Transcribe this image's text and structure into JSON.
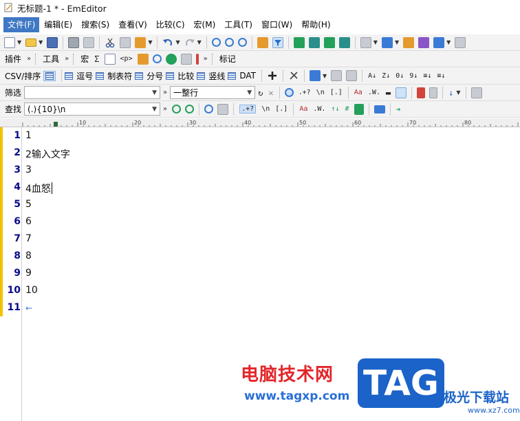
{
  "window": {
    "title": "无标题-1 * - EmEditor"
  },
  "menu": [
    "文件(F)",
    "编辑(E)",
    "搜索(S)",
    "查看(V)",
    "比较(C)",
    "宏(M)",
    "工具(T)",
    "窗口(W)",
    "帮助(H)"
  ],
  "menu_active_index": 0,
  "toolbar2": {
    "plugins_label": "插件",
    "tools_label": "工具",
    "more": "»",
    "macro_label": "宏",
    "sigma": "Σ",
    "p_tag": "<p>",
    "bookmark_label": "标记"
  },
  "csv_toolbar": {
    "csv_sort_label": "CSV/排序",
    "buttons": [
      "逗号",
      "制表符",
      "分号",
      "比较",
      "竖线",
      "DAT"
    ]
  },
  "filter_toolbar": {
    "label": "筛选",
    "filter_value": "",
    "scope_value": "一整行",
    "regex_label": ".+?",
    "newline_label": "\\n",
    "bracket_label": "[.]",
    "case_label": "Aa",
    "word_label": ".W."
  },
  "find_toolbar": {
    "label": "查找",
    "find_value": "(.){10}\\n",
    "regex_label": ".+?",
    "newline_label": "\\n",
    "bracket_label": "[.]",
    "case_label": "Aa",
    "word_label": ".W."
  },
  "ruler": {
    "labels": [
      "10",
      "20",
      "30",
      "40",
      "50",
      "60",
      "70",
      "80"
    ]
  },
  "editor": {
    "lines": [
      {
        "num": "1",
        "text": "1"
      },
      {
        "num": "2",
        "text": "2输入文字"
      },
      {
        "num": "3",
        "text": "3"
      },
      {
        "num": "4",
        "text": "4血怒"
      },
      {
        "num": "5",
        "text": "5"
      },
      {
        "num": "6",
        "text": "6"
      },
      {
        "num": "7",
        "text": "7"
      },
      {
        "num": "8",
        "text": "8"
      },
      {
        "num": "9",
        "text": "9"
      },
      {
        "num": "10",
        "text": "10"
      },
      {
        "num": "11",
        "text": ""
      }
    ],
    "eof_mark": "←",
    "caret_line": 4
  },
  "watermark": {
    "title": "电脑技术网",
    "url": "www.tagxp.com",
    "logo": "TAG",
    "site": "极光下载站",
    "site_url": "www.xz7.com"
  },
  "colors": {
    "menu_active": "#3f78c4",
    "line_number": "#0a0a8a",
    "change_bar": "#f2c200",
    "watermark_red": "#e2262a",
    "watermark_blue": "#1b63c9"
  }
}
